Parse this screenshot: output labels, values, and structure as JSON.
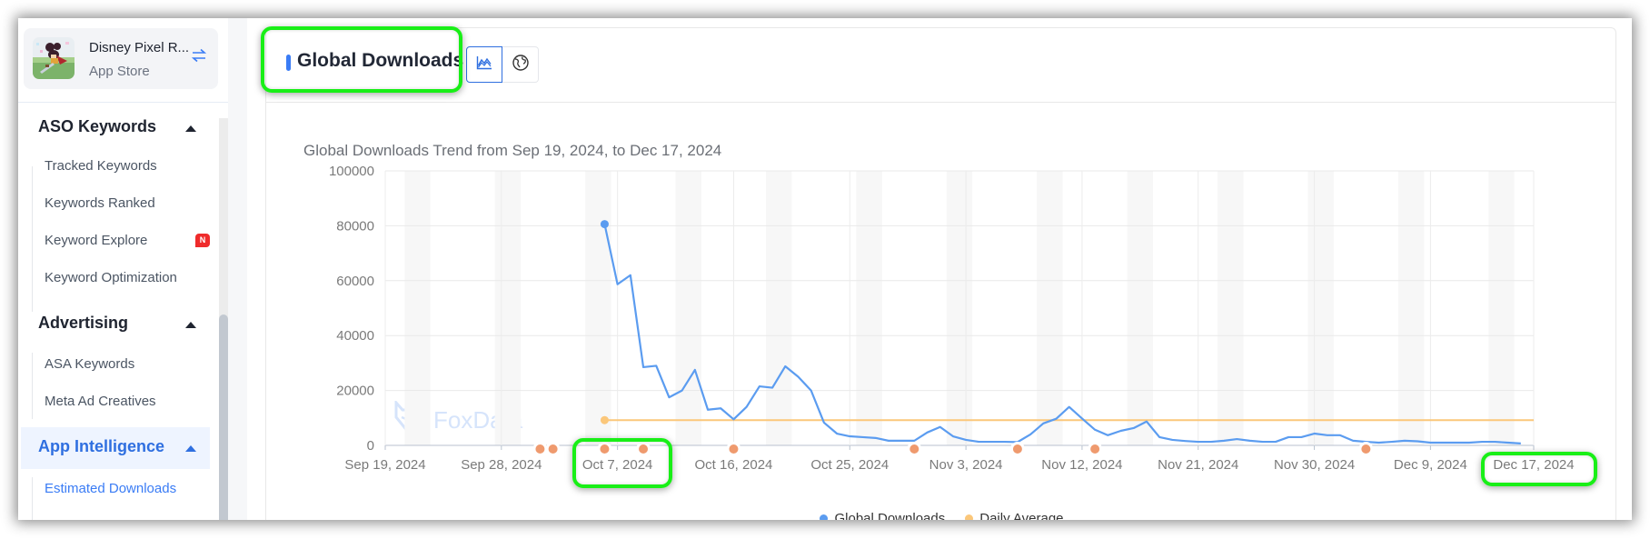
{
  "app": {
    "name": "Disney Pixel R...",
    "store": "App Store",
    "icon": "app-icon-pixel-character",
    "switch_icon": "swap-icon"
  },
  "sidebar": {
    "sections": [
      {
        "label": "ASO Keywords",
        "expanded": true,
        "active": false,
        "items": [
          {
            "label": "Tracked Keywords"
          },
          {
            "label": "Keywords Ranked"
          },
          {
            "label": "Keyword Explore",
            "badge": "N"
          },
          {
            "label": "Keyword Optimization"
          }
        ]
      },
      {
        "label": "Advertising",
        "expanded": true,
        "active": false,
        "items": [
          {
            "label": "ASA Keywords"
          },
          {
            "label": "Meta Ad Creatives"
          }
        ]
      },
      {
        "label": "App Intelligence",
        "expanded": true,
        "active": true,
        "items": [
          {
            "label": "Estimated Downloads",
            "active": true
          }
        ]
      }
    ]
  },
  "card": {
    "title": "Global Downloads",
    "view_buttons": [
      {
        "name": "trend-chart",
        "icon": "area-chart-icon",
        "active": true
      },
      {
        "name": "world-map",
        "icon": "globe-icon",
        "active": false
      }
    ],
    "watermark": "FoxData"
  },
  "colors": {
    "accent": "#3a7cf5",
    "series_downloads": "#5b9cf0",
    "series_average": "#fbc77a",
    "event_marker": "#ef9a6e",
    "highlight": "#19ef17"
  },
  "chart_data": {
    "type": "line",
    "title": "Global Downloads Trend from Sep 19, 2024, to Dec 17, 2024",
    "xlabel": "",
    "ylabel": "",
    "x_start": "2024-09-19",
    "x_end": "2024-12-17",
    "x_tick_labels": [
      "Sep 19, 2024",
      "Sep 28, 2024",
      "Oct 7, 2024",
      "Oct 16, 2024",
      "Oct 25, 2024",
      "Nov 3, 2024",
      "Nov 12, 2024",
      "Nov 21, 2024",
      "Nov 30, 2024",
      "Dec 9, 2024",
      "Dec 17, 2024"
    ],
    "x_tick_day_offsets": [
      0,
      9,
      18,
      27,
      36,
      45,
      54,
      63,
      72,
      81,
      89
    ],
    "y_ticks": [
      0,
      20000,
      40000,
      60000,
      80000,
      100000
    ],
    "ylim": [
      0,
      100000
    ],
    "grid": true,
    "weekend_shading": true,
    "legend_position": "bottom",
    "series": [
      {
        "name": "Global Downloads",
        "start_date": "2024-10-06",
        "values": [
          80600,
          58700,
          62000,
          28500,
          29000,
          17500,
          20000,
          27500,
          13000,
          13500,
          9500,
          14000,
          21500,
          21000,
          28800,
          25000,
          20000,
          8300,
          4300,
          3300,
          3000,
          2700,
          1700,
          1700,
          1700,
          4700,
          6700,
          3300,
          2000,
          1300,
          1300,
          1300,
          1200,
          4000,
          8000,
          9700,
          14000,
          9800,
          5700,
          3700,
          5300,
          6300,
          8700,
          3000,
          2000,
          1600,
          1300,
          1300,
          1700,
          2300,
          1700,
          1300,
          1300,
          3000,
          3000,
          4300,
          3700,
          3700,
          1700,
          1300,
          1000,
          1300,
          1700,
          1500,
          1000,
          1000,
          1000,
          1000,
          1300,
          1300,
          1000,
          700
        ]
      },
      {
        "name": "Daily Average",
        "start_date": "2024-10-06",
        "constant_value": 9200
      }
    ],
    "event_markers_dates": [
      "2024-10-01",
      "2024-10-02",
      "2024-10-06",
      "2024-10-09",
      "2024-10-16",
      "2024-10-30",
      "2024-11-07",
      "2024-11-13",
      "2024-12-04"
    ],
    "legend": [
      "Global Downloads",
      "Daily Average"
    ]
  }
}
